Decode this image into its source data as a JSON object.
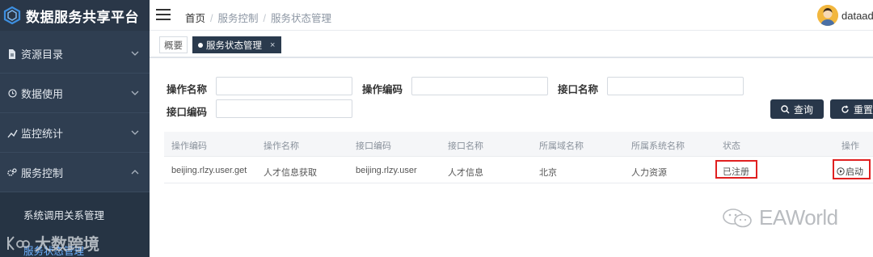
{
  "sidebar": {
    "brand_title": "数据服务共享平台",
    "menu": [
      {
        "label": "资源目录",
        "icon": "document-icon",
        "chevron": "chevron-down"
      },
      {
        "label": "数据使用",
        "icon": "clock-icon",
        "chevron": "chevron-down"
      },
      {
        "label": "监控统计",
        "icon": "monitor-icon",
        "chevron": "chevron-down"
      },
      {
        "label": "服务控制",
        "icon": "cogs-icon",
        "chevron": "chevron-up"
      }
    ],
    "submenu": [
      {
        "label": "系统调用关系管理",
        "active": false
      },
      {
        "label": "服务状态管理",
        "active": true
      }
    ]
  },
  "header": {
    "breadcrumb": [
      "首页",
      "服务控制",
      "服务状态管理"
    ],
    "username": "dataad"
  },
  "tabs": [
    {
      "label": "概要",
      "active": false
    },
    {
      "label": "服务状态管理",
      "active": true,
      "close": "×"
    }
  ],
  "filters": {
    "op_name_label": "操作名称",
    "op_code_label": "操作编码",
    "iface_name_label": "接口名称",
    "iface_code_label": "接口编码",
    "op_name_value": "",
    "op_code_value": "",
    "iface_name_value": "",
    "iface_code_value": ""
  },
  "buttons": {
    "query": "查询",
    "reset": "重置"
  },
  "table": {
    "columns": [
      "操作编码",
      "操作名称",
      "接口编码",
      "接口名称",
      "所属域名称",
      "所属系统名称",
      "状态",
      "操作"
    ],
    "rows": [
      {
        "op_code": "beijing.rlzy.user.get",
        "op_name": "人才信息获取",
        "iface_code": "beijing.rlzy.user",
        "iface_name": "人才信息",
        "domain": "北京",
        "system": "人力资源",
        "status": "已注册",
        "action": "启动"
      }
    ]
  },
  "watermarks": {
    "right": "EAWorld",
    "left": "大数跨境"
  },
  "colors": {
    "sidebar_bg": "#2f3e51",
    "accent_dark": "#28374a",
    "highlight_red": "#e02020",
    "submenu_active": "#6fb1ff"
  }
}
